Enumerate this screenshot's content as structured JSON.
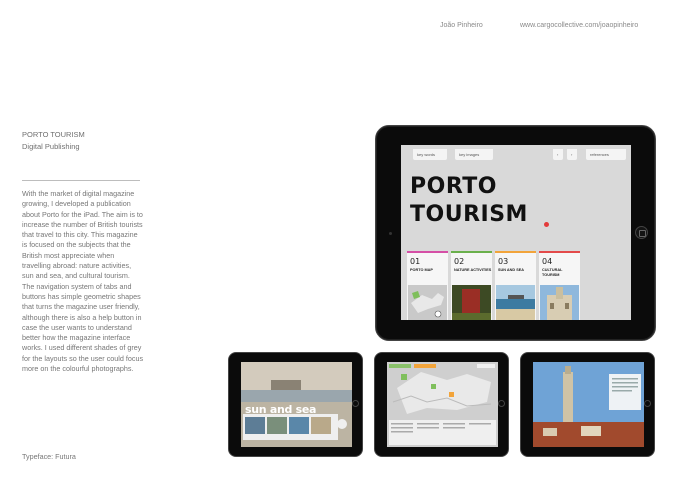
{
  "header": {
    "name": "João Pinheiro",
    "url": "www.cargocollective.com/joaopinheiro"
  },
  "project": {
    "title": "PORTO TOURISM",
    "subtitle": "Digital Publishing",
    "description": "With the market of digital magazine growing, I developed a publication about Porto for the iPad. The aim is to increase the number of British tourists that travel to this city. This magazine is focused on the subjects that the British most appreciate when travelling abroad: nature activities, sun and sea, and cultural tourism. The navigation system of tabs and buttons has simple geometric shapes that turns the magazine user friendly, although there is also a help button in case the user wants to understand better how the magazine interface works. I used different shades of grey for the layouts so the user could focus more on the colourful photographs.",
    "typeface": "Typeface: Futura"
  },
  "magazine": {
    "tabs": {
      "key_words": "key words",
      "key_images": "key images",
      "prev": "‹",
      "next": "›",
      "references": "references"
    },
    "title_line1": "PORTO",
    "title_line2": "TOURISM",
    "sections": [
      {
        "num": "01",
        "label": "PORTO MAP",
        "color": "#d54fa6"
      },
      {
        "num": "02",
        "label": "NATURE ACTIVITIES",
        "color": "#6ab04c"
      },
      {
        "num": "03",
        "label": "SUN AND SEA",
        "color": "#f2a43a"
      },
      {
        "num": "04",
        "label": "CULTURAL TOURISM",
        "color": "#e34a4a"
      }
    ],
    "sun_and_sea": "sun and sea"
  },
  "colors": {
    "bezel": "#0b0b0b",
    "screen_grey": "#d9d9d9",
    "accent_red": "#e33b3b"
  }
}
